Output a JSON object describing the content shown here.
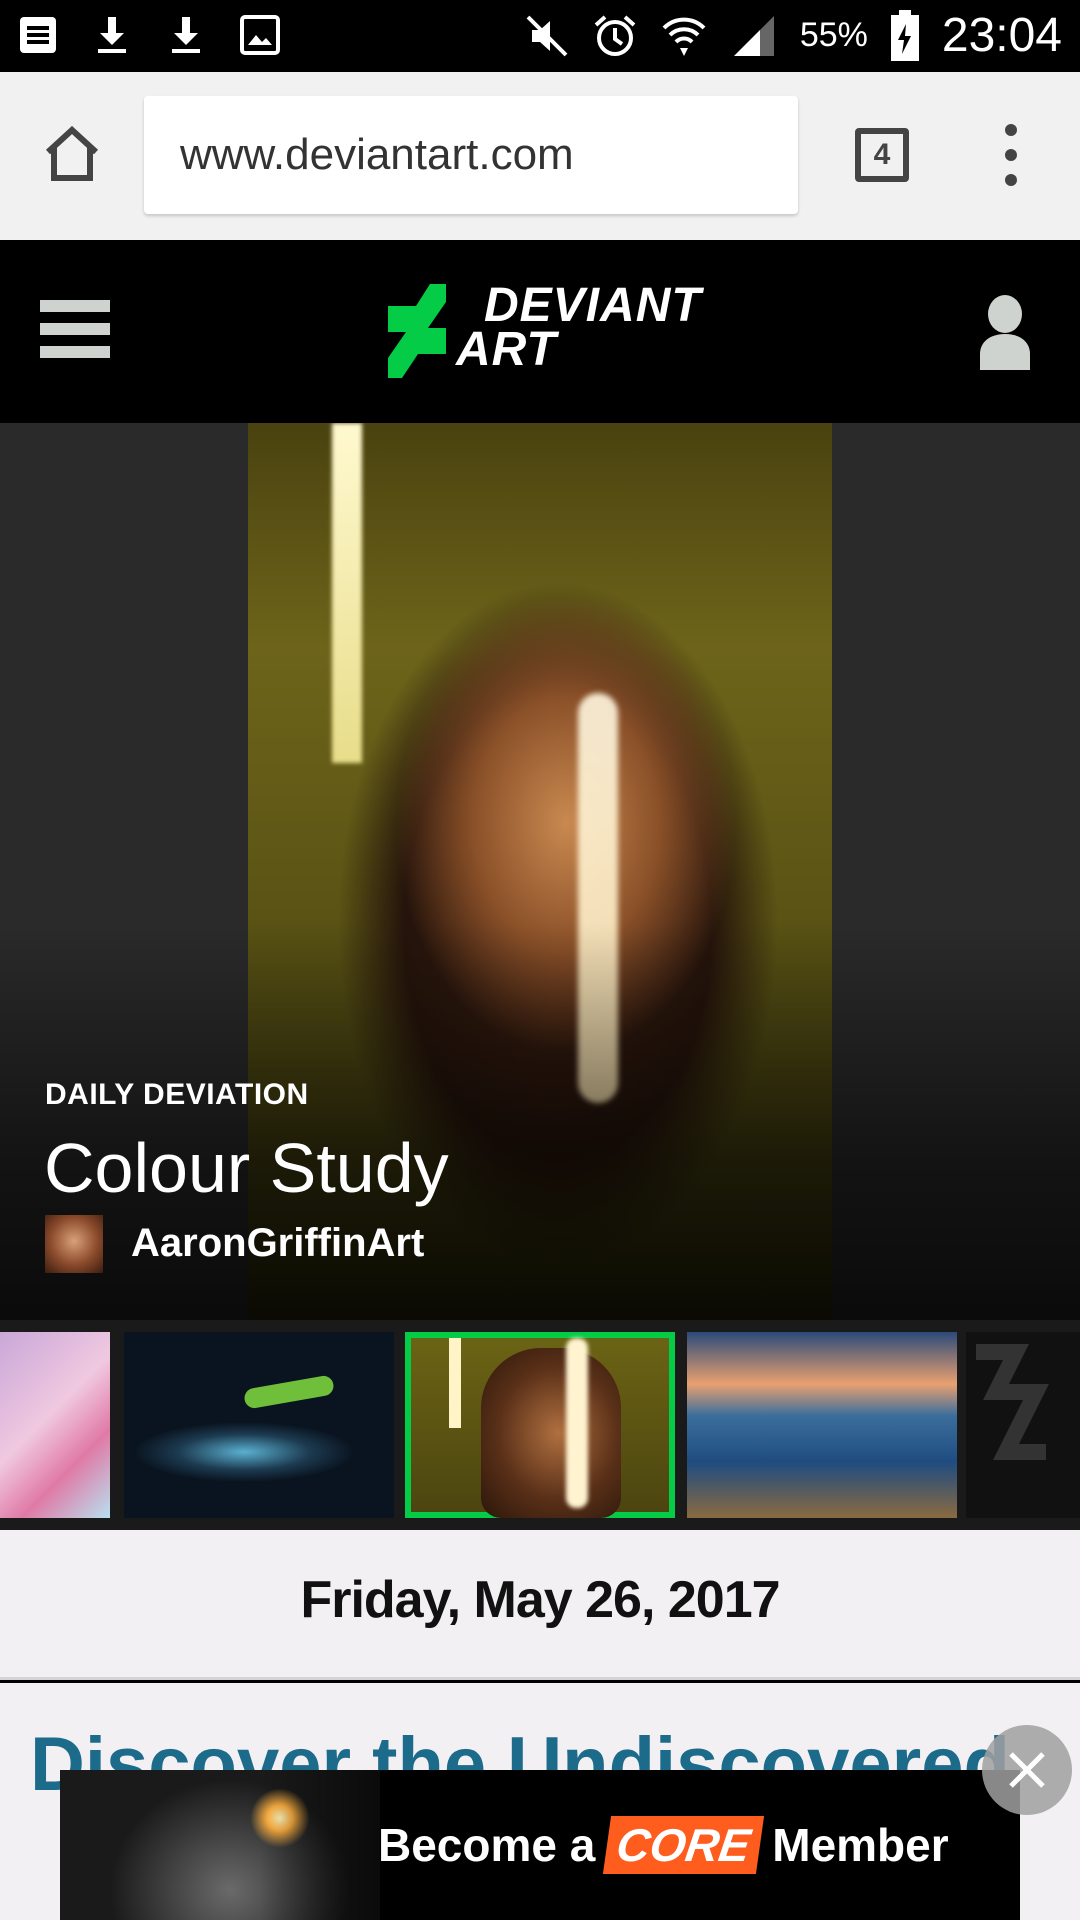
{
  "status_bar": {
    "icons_left": [
      "notes-icon",
      "download-icon",
      "download-icon",
      "image-icon"
    ],
    "icons_right": [
      "mute-icon",
      "alarm-icon",
      "wifi-icon",
      "signal-icon"
    ],
    "battery_percent": "55%",
    "time": "23:04"
  },
  "browser": {
    "url": "www.deviantart.com",
    "tab_count": "4"
  },
  "site_header": {
    "logo_line1": "DEVIANT",
    "logo_line2": "ART",
    "logo_color": "#05cc47"
  },
  "daily_deviation": {
    "label": "DAILY DEVIATION",
    "title": "Colour Study",
    "artist": "AaronGriffinArt"
  },
  "thumbnails": {
    "selected_index": 2,
    "count": 5,
    "selected_border_color": "#05cc47"
  },
  "date": "Friday, May 26, 2017",
  "section_heading": "Discover the Undiscovered",
  "ad": {
    "text_before": "Become a",
    "highlight": "CORE",
    "text_after": "Member",
    "highlight_color": "#ff5d1e"
  }
}
